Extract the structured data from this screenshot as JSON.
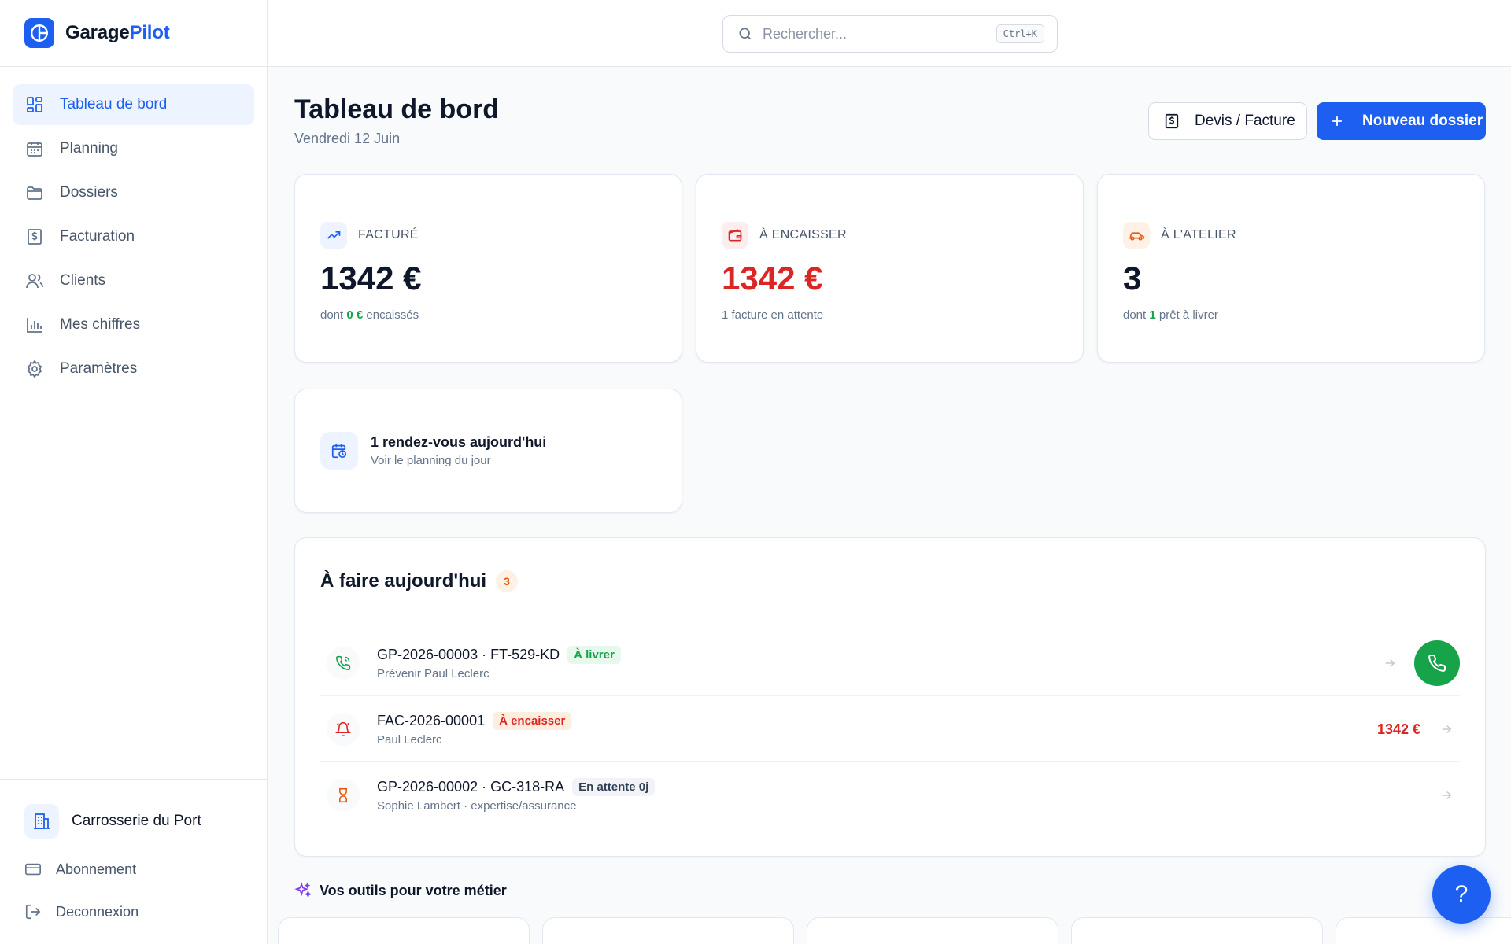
{
  "brand": {
    "name_part1": "Garage",
    "name_part2": "Pilot"
  },
  "sidebar": {
    "items": [
      {
        "label": "Tableau de bord",
        "icon": "dashboard-icon",
        "active": true
      },
      {
        "label": "Planning",
        "icon": "calendar-icon"
      },
      {
        "label": "Dossiers",
        "icon": "folder-icon"
      },
      {
        "label": "Facturation",
        "icon": "invoice-icon"
      },
      {
        "label": "Clients",
        "icon": "users-icon"
      },
      {
        "label": "Mes chiffres",
        "icon": "bar-chart-icon"
      },
      {
        "label": "Paramètres",
        "icon": "gear-icon"
      }
    ],
    "garage_name": "Carrosserie du Port",
    "subscription_label": "Abonnement",
    "logout_label": "Deconnexion"
  },
  "search": {
    "placeholder": "Rechercher...",
    "shortcut": "Ctrl+K"
  },
  "page": {
    "title": "Tableau de bord",
    "date": "Vendredi 12 Juin",
    "quote_button": "Devis / Facture",
    "new_button": "Nouveau dossier"
  },
  "stats": [
    {
      "label": "FACTURÉ",
      "value": "1342 €",
      "sub_prefix": "dont ",
      "sub_highlight": "0 €",
      "sub_suffix": " encaissés",
      "icon": "trending-up-icon"
    },
    {
      "label": "À ENCAISSER",
      "value": "1342 €",
      "sub": "1 facture en attente",
      "icon": "wallet-icon"
    },
    {
      "label": "À L'ATELIER",
      "value": "3",
      "sub_prefix": "dont ",
      "sub_highlight": "1",
      "sub_suffix": " prêt à livrer",
      "icon": "car-icon"
    }
  ],
  "appointments": {
    "title": "1 rendez-vous aujourd'hui",
    "subtitle": "Voir le planning du jour"
  },
  "todo": {
    "title": "À faire aujourd'hui",
    "count": "3",
    "rows": [
      {
        "title": "GP-2026-00003 · FT-529-KD",
        "badge": "À livrer",
        "subtitle": "Prévenir Paul Leclerc",
        "icon": "phone-icon"
      },
      {
        "title": "FAC-2026-00001",
        "badge": "À encaisser",
        "subtitle": "Paul Leclerc",
        "amount": "1342 €",
        "icon": "bell-icon"
      },
      {
        "title": "GP-2026-00002 · GC-318-RA",
        "badge": "En attente 0j",
        "subtitle": "Sophie Lambert · expertise/assurance",
        "icon": "hourglass-icon"
      }
    ]
  },
  "tools": {
    "title": "Vos outils pour votre métier"
  },
  "help_label": "?",
  "colors": {
    "primary": "#1d5ff0",
    "success": "#16a34a",
    "danger": "#dc2626",
    "warning": "#ea580c"
  }
}
